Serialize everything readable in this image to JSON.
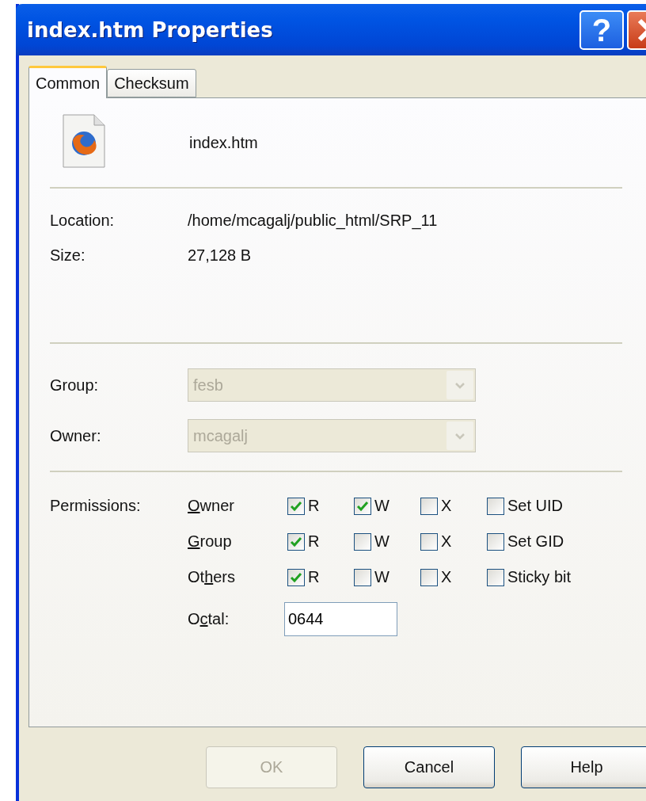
{
  "window": {
    "title": "index.htm Properties",
    "help_label": "?"
  },
  "tabs": [
    {
      "label": "Common",
      "selected": true
    },
    {
      "label": "Checksum",
      "selected": false
    }
  ],
  "file": {
    "name": "index.htm"
  },
  "info": [
    {
      "label": "Location:",
      "value": "/home/mcagalj/public_html/SRP_11"
    },
    {
      "label": "Size:",
      "value": "27,128 B"
    }
  ],
  "combos": [
    {
      "label": "Group:",
      "value": "fesb",
      "disabled": true
    },
    {
      "label": "Owner:",
      "value": "mcagalj",
      "disabled": true
    }
  ],
  "permissions": {
    "label": "Permissions:",
    "rows": [
      {
        "pre": "",
        "key": "O",
        "post": "wner",
        "options": [
          {
            "label": "R",
            "checked": true
          },
          {
            "label": "W",
            "checked": true
          },
          {
            "label": "X",
            "checked": false
          },
          {
            "label": "Set UID",
            "checked": false
          }
        ]
      },
      {
        "pre": "",
        "key": "G",
        "post": "roup",
        "options": [
          {
            "label": "R",
            "checked": true
          },
          {
            "label": "W",
            "checked": false
          },
          {
            "label": "X",
            "checked": false
          },
          {
            "label": "Set GID",
            "checked": false
          }
        ]
      },
      {
        "pre": "Ot",
        "key": "h",
        "post": "ers",
        "options": [
          {
            "label": "R",
            "checked": true
          },
          {
            "label": "W",
            "checked": false
          },
          {
            "label": "X",
            "checked": false
          },
          {
            "label": "Sticky bit",
            "checked": false
          }
        ]
      }
    ],
    "octal": {
      "pre": "O",
      "key": "c",
      "post": "tal:",
      "value": "0644"
    }
  },
  "buttons": [
    {
      "label": "OK",
      "disabled": true
    },
    {
      "label": "Cancel",
      "disabled": false
    },
    {
      "label": "Help",
      "disabled": false
    }
  ]
}
